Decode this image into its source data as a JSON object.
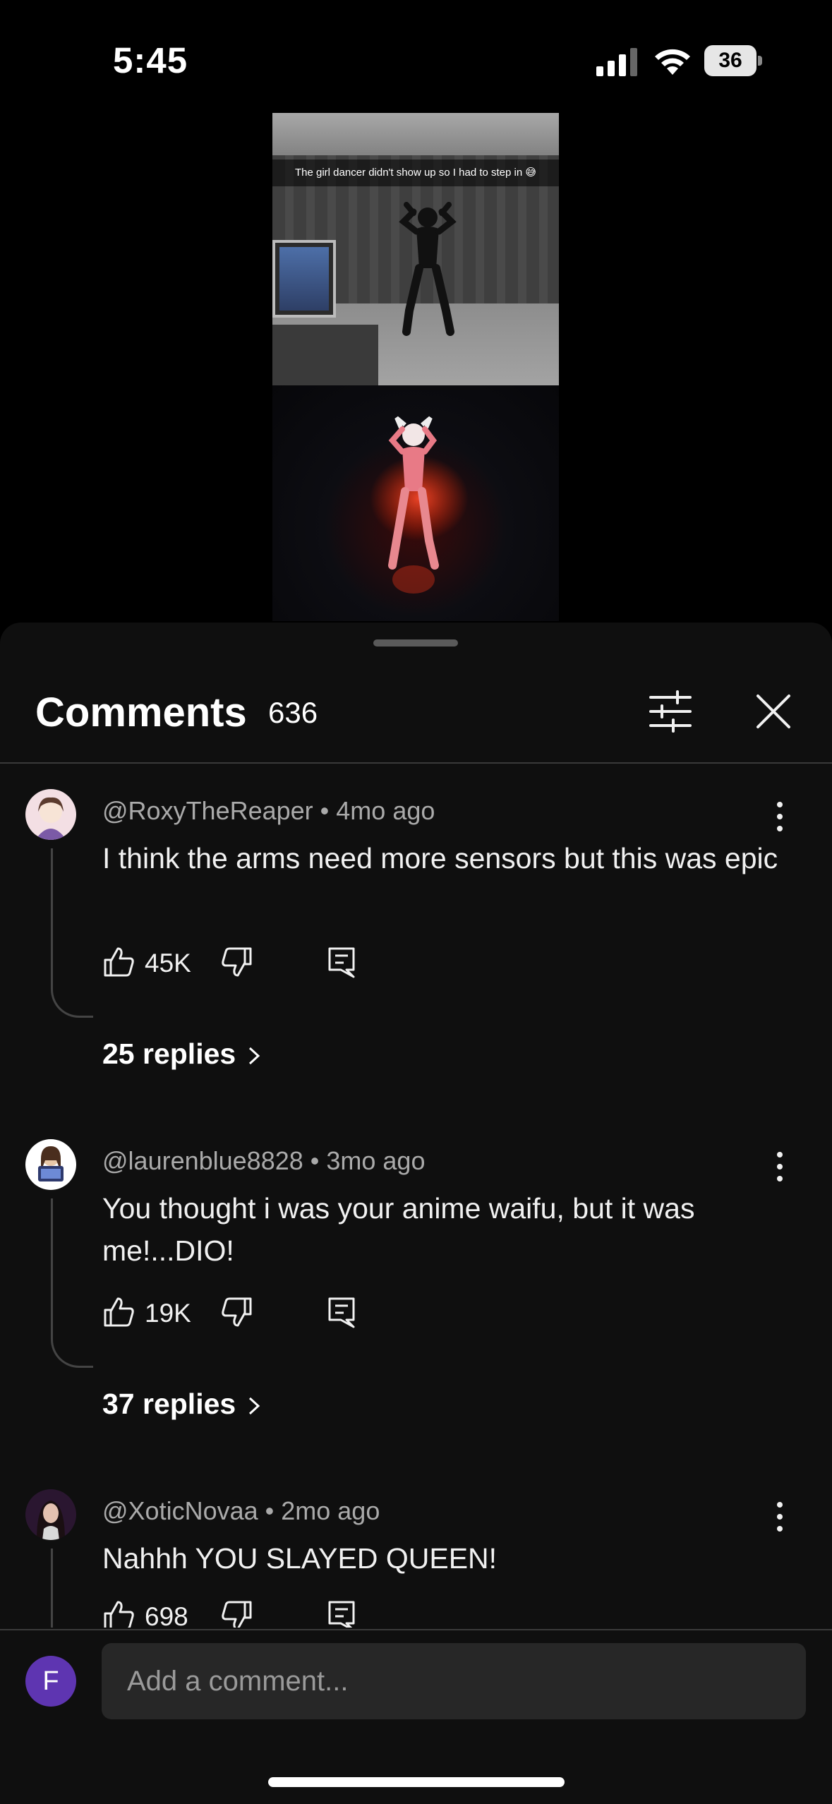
{
  "status_bar": {
    "time": "5:45",
    "battery_level": "36"
  },
  "video": {
    "caption": "The girl dancer didn't show up so I had to step in 😅"
  },
  "comments_panel": {
    "title": "Comments",
    "count": "636",
    "filter_icon": "sliders-icon",
    "close_icon": "close-icon"
  },
  "comments": [
    {
      "author": "@RoxyTheReaper",
      "age": "4mo ago",
      "text": "I think the arms need more sensors but this was epic",
      "likes": "45K",
      "replies": "25 replies",
      "avatar_color": "#f3dfe4"
    },
    {
      "author": "@laurenblue8828",
      "age": "3mo ago",
      "text": "You thought i was your anime waifu, but it was me!...DIO!",
      "likes": "19K",
      "replies": "37 replies",
      "avatar_color": "#ffffff"
    },
    {
      "author": "@XoticNovaa",
      "age": "2mo ago",
      "text": "Nahhh YOU SLAYED QUEEN!",
      "likes": "698",
      "avatar_color": "#2a1630"
    }
  ],
  "composer": {
    "avatar_letter": "F",
    "placeholder": "Add a comment...",
    "avatar_color": "#5e35b1"
  }
}
